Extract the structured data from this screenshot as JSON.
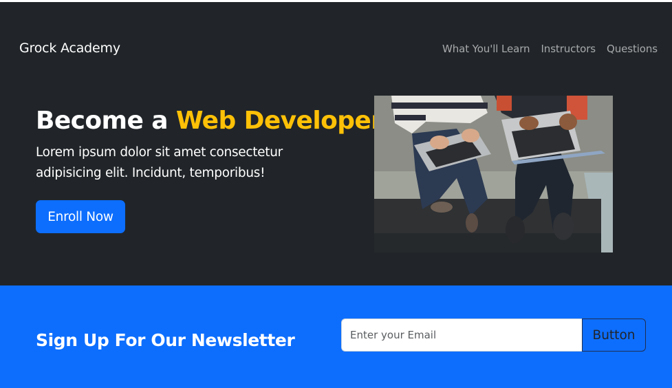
{
  "navbar": {
    "brand": "Grock Academy",
    "links": [
      "What You'll Learn",
      "Instructors",
      "Questions"
    ]
  },
  "hero": {
    "title_prefix": "Become a ",
    "title_accent": "Web Developer",
    "text": "Lorem ipsum dolor sit amet consectetur adipisicing elit. Incidunt, temporibus!",
    "cta_label": "Enroll Now",
    "image_icon": "laptops-photo-icon"
  },
  "newsletter": {
    "title": "Sign Up For Our Newsletter",
    "email_placeholder": "Enter your Email",
    "email_value": "",
    "button_label": "Button"
  },
  "colors": {
    "dark_bg": "#212529",
    "accent": "#ffc107",
    "primary": "#0d6efd"
  }
}
